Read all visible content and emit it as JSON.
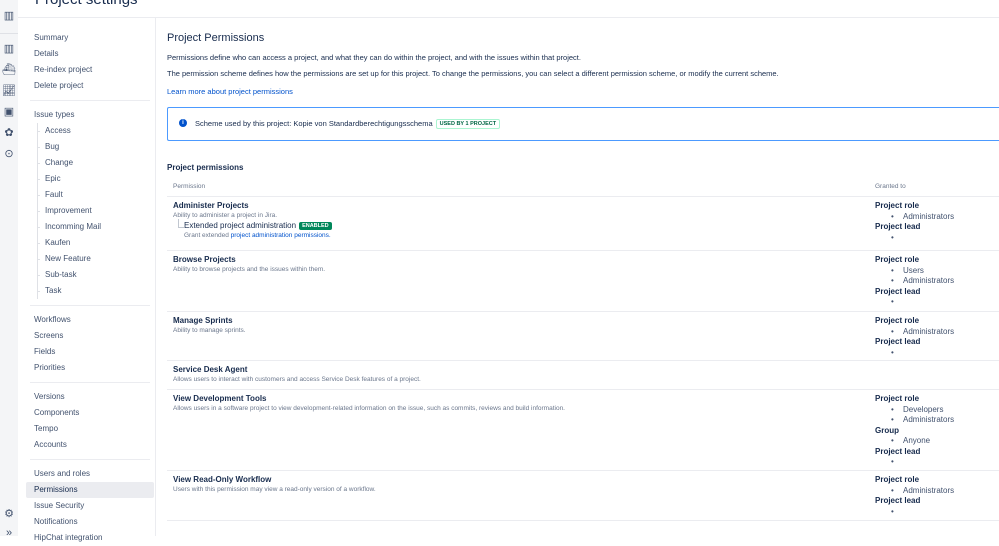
{
  "header": {
    "title": "Project settings"
  },
  "nav": {
    "group1": [
      "Summary",
      "Details",
      "Re-index project",
      "Delete project"
    ],
    "issue_types_label": "Issue types",
    "issue_types": [
      "Access",
      "Bug",
      "Change",
      "Epic",
      "Fault",
      "Improvement",
      "Incomming Mail",
      "Kaufen",
      "New Feature",
      "Sub-task",
      "Task"
    ],
    "group3": [
      "Workflows",
      "Screens",
      "Fields",
      "Priorities"
    ],
    "group4": [
      "Versions",
      "Components",
      "Tempo",
      "Accounts"
    ],
    "group5": [
      "Users and roles",
      "Permissions",
      "Issue Security",
      "Notifications",
      "HipChat integration"
    ]
  },
  "main": {
    "title": "Project Permissions",
    "intro1": "Permissions define who can access a project, and what they can do within the project, and with the issues within that project.",
    "intro2": "The permission scheme defines how the permissions are set up for this project. To change the permissions, you can select a different permission scheme, or modify the current scheme.",
    "learn_more": "Learn more about project permissions",
    "scheme_text": "Scheme used by this project: Kopie von Standardberechtigungsschema",
    "scheme_badge": "USED BY 1 PROJECT",
    "section": "Project permissions",
    "col_permission": "Permission",
    "col_granted": "Granted to",
    "ext_label": "Extended project administration",
    "ext_badge": "ENABLED",
    "ext_grant_prefix": "Grant extended",
    "ext_grant_link": "project administration permissions."
  },
  "permissions": [
    {
      "name": "Administer Projects",
      "desc": "Ability to administer a project in Jira.",
      "role": "Project role",
      "role_items": [
        "Administrators"
      ],
      "lead": "Project lead"
    },
    {
      "name": "Browse Projects",
      "desc": "Ability to browse projects and the issues within them.",
      "role": "Project role",
      "role_items": [
        "Users",
        "Administrators"
      ],
      "lead": "Project lead"
    },
    {
      "name": "Manage Sprints",
      "desc": "Ability to manage sprints.",
      "role": "Project role",
      "role_items": [
        "Administrators"
      ],
      "lead": "Project lead"
    },
    {
      "name": "Service Desk Agent",
      "desc": "Allows users to interact with customers and access Service Desk features of a project."
    },
    {
      "name": "View Development Tools",
      "desc": "Allows users in a software project to view development-related information on the issue, such as commits, reviews and build information.",
      "role": "Project role",
      "role_items": [
        "Developers",
        "Administrators"
      ],
      "group": "Group",
      "group_items": [
        "Anyone"
      ],
      "lead": "Project lead"
    },
    {
      "name": "View Read-Only Workflow",
      "desc": "Users with this permission may view a read-only version of a workflow.",
      "role": "Project role",
      "role_items": [
        "Administrators"
      ],
      "lead": "Project lead"
    }
  ]
}
